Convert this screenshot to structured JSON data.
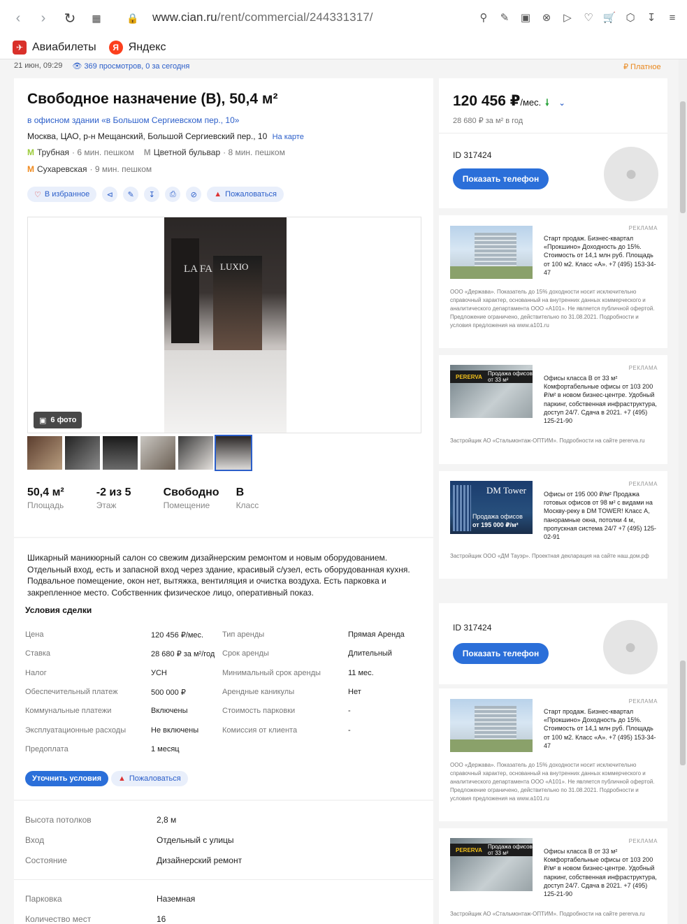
{
  "browser": {
    "url_host": "www.cian.ru",
    "url_path": "/rent/commercial/244331317/",
    "bookmarks": [
      {
        "label": "Авиабилеты",
        "color": "#d9302a"
      },
      {
        "label": "Яндекс",
        "color": "#fc3f1d"
      }
    ]
  },
  "meta": {
    "date": "21 июн, 09:29",
    "views": "369 просмотров, 0 за сегодня",
    "paid": "₽ Платное"
  },
  "listing": {
    "title": "Свободное назначение (B), 50,4 м²",
    "building": "в офисном здании «в Большом Сергиевском пер., 10»",
    "address": "Москва, ЦАО, р-н Мещанский, Большой Сергиевский пер., 10",
    "map_link": "На карте",
    "metro": [
      {
        "name": "Трубная",
        "time": "· 6 мин. пешком",
        "color": "#9ccc3a"
      },
      {
        "name": "Цветной бульвар",
        "time": "· 8 мин. пешком",
        "color": "#999999"
      },
      {
        "name": "Сухаревская",
        "time": "· 9 мин. пешком",
        "color": "#f08a1e"
      }
    ],
    "actions": {
      "favorite": "В избранное",
      "complain": "Пожаловаться"
    },
    "photo_count": "6 фото",
    "photo_texts": {
      "brand": "LUXIO",
      "lafa": "LA FA"
    },
    "stats": [
      {
        "value": "50,4 м²",
        "label": "Площадь"
      },
      {
        "value": "-2 из 5",
        "label": "Этаж"
      },
      {
        "value": "Свободно",
        "label": "Помещение"
      },
      {
        "value": "B",
        "label": "Класс"
      }
    ],
    "description": "Шикарный маникюрный салон со свежим дизайнерским ремонтом и новым оборудованием. Отдельный вход, есть и запасной вход через здание, красивый с/узел, есть оборудованная кухня. Подвальное помещение, окон нет, вытяжка, вентиляция и очистка воздуха. Есть парковка и закрепленное место. Собственник физическое лицо, оперативный показ."
  },
  "terms": {
    "title": "Условия сделки",
    "rows": [
      {
        "k1": "Цена",
        "v1": "120 456 ₽/мес.",
        "k2": "Тип аренды",
        "v2": "Прямая Аренда"
      },
      {
        "k1": "Ставка",
        "v1": "28 680 ₽ за м²/год",
        "k2": "Срок аренды",
        "v2": "Длительный"
      },
      {
        "k1": "Налог",
        "v1": "УСН",
        "k2": "Минимальный срок аренды",
        "v2": "11 мес."
      },
      {
        "k1": "Обеспечительный платеж",
        "v1": "500 000 ₽",
        "k2": "Арендные каникулы",
        "v2": "Нет"
      },
      {
        "k1": "Коммунальные платежи",
        "v1": "Включены",
        "k2": "Стоимость парковки",
        "v2": "-"
      },
      {
        "k1": "Эксплуатационные расходы",
        "v1": "Не включены",
        "k2": "Комиссия от клиента",
        "v2": "-"
      },
      {
        "k1": "Предоплата",
        "v1": "1 месяц",
        "k2": "",
        "v2": ""
      }
    ],
    "clarify_btn": "Уточнить условия",
    "complain": "Пожаловаться"
  },
  "features": [
    {
      "k": "Высота потолков",
      "v": "2,8 м"
    },
    {
      "k": "Вход",
      "v": "Отдельный с улицы"
    },
    {
      "k": "Состояние",
      "v": "Дизайнерский ремонт"
    },
    {
      "k": "Парковка",
      "v": "Наземная"
    },
    {
      "k": "Количество мест",
      "v": "16"
    }
  ],
  "sidebar": {
    "price": "120 456 ₽",
    "price_unit": "/мес.",
    "price_sub": "28 680 ₽ за м² в год",
    "id_label": "ID 317424",
    "phone_btn": "Показать телефон",
    "ad_tag": "РЕКЛАМА",
    "ads": [
      {
        "text": "Старт продаж. Бизнес-квартал «Прокшино» Доходность до 15%. Стоимость от 14,1 млн руб. Площадь от 100 м2. Класс «А». +7 (495) 153-34-47",
        "footer": "ООО «Держава». Показатель до 15% доходности носит исключительно справочный характер, основанный на внутренних данных коммерческого и аналитического департамента ООО «А101». Не является публичной офертой. Предложение ограничено, действительно по 31.08.2021. Подробности и условия предложения на www.a101.ru"
      },
      {
        "text": "Офисы класса В от 33 м² Комфортабельные офисы от 103 200 ₽/м² в новом бизнес-центре. Удобный паркинг, собственная инфраструктура, доступ 24/7. Сдача в 2021. +7 (495) 125-21-90",
        "footer": "Застройщик АО «Стальмонтаж-ОПТИМ». Подробности на сайте pererva.ru",
        "img_label": "PERERVA",
        "img_sub": "Продажа офисов от 33 м²"
      },
      {
        "text": "Офисы от 195 000 ₽/м² Продажа готовых офисов от 98 м² с видами на Москву-реку в DM TOWER! Класс А, панорамные окна, потолки 4 м, пропускная система 24/7 +7 (495) 125-02-91",
        "footer": "Застройщик ООО «ДМ Тауэр». Проектная декларация на сайте наш.дом.рф",
        "img_name": "DM Tower",
        "img_s1": "Продажа офисов",
        "img_s2": "от 195 000 ₽/м²"
      }
    ]
  }
}
